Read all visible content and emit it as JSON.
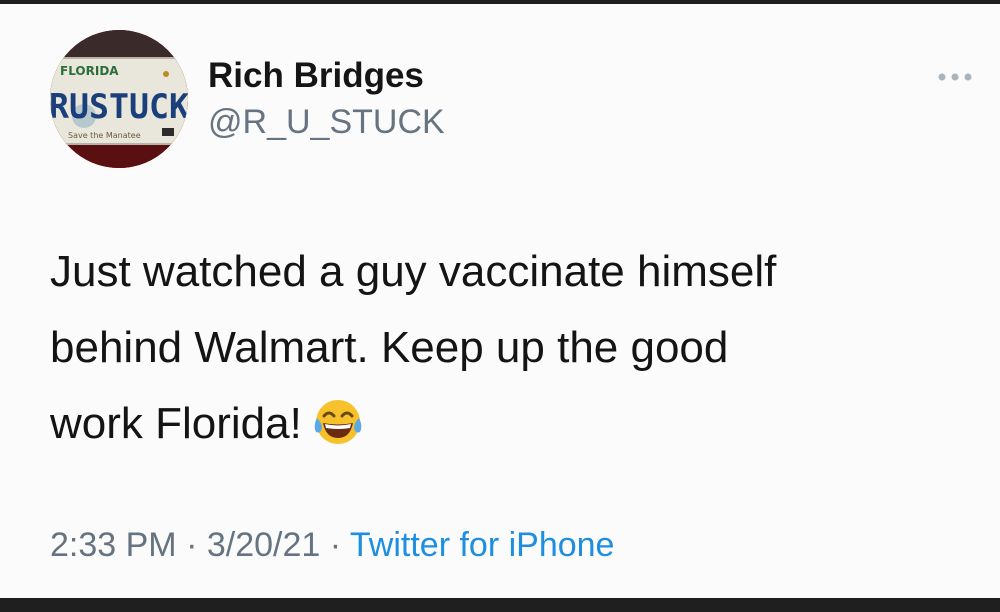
{
  "tweet": {
    "author": {
      "display_name": "Rich Bridges",
      "handle": "@R_U_STUCK",
      "avatar": {
        "plate_state": "FLORIDA",
        "plate_text": "RUSTUCK",
        "plate_tagline": "Save the Manatee"
      }
    },
    "more_icon": "ellipsis-icon",
    "text_lines": [
      "Just watched a guy vaccinate himself",
      "behind Walmart. Keep up the good",
      "work Florida!"
    ],
    "emoji": "tears-of-joy-emoji",
    "meta": {
      "time": "2:33 PM",
      "separator": " · ",
      "date": "3/20/21",
      "source": "Twitter for iPhone"
    }
  },
  "colors": {
    "name": "#151515",
    "secondary": "#667380",
    "link": "#1d8ee0",
    "background": "#fbfbfb",
    "frame": "#1f1f1f"
  }
}
